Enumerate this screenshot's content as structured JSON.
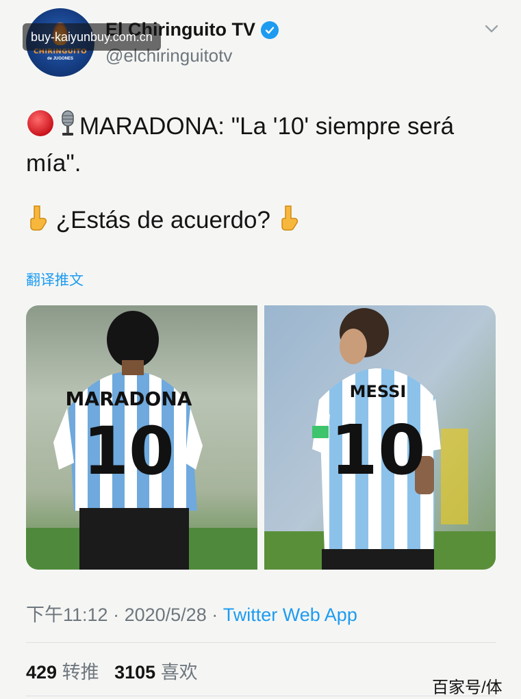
{
  "tweet": {
    "avatar_logo": "CHIRINGUITO",
    "avatar_logo_sub": "de JUGONES",
    "display_name": "El Chiringuito TV",
    "handle": "@elchiringuitotv",
    "line1": "MARADONA: \"La '10' siempre será",
    "line2": "mía\".",
    "line3": "¿Estás de acuerdo?",
    "translate_link": "翻译推文",
    "time": "下午11:12",
    "date": "2020/5/28",
    "separator": "·",
    "source_app": "Twitter Web App",
    "retweets_count": "429",
    "retweets_label": "转推",
    "likes_count": "3105",
    "likes_label": "喜欢"
  },
  "media": {
    "left_jersey_name": "MARADONA",
    "left_jersey_number": "10",
    "right_jersey_name": "MESSI",
    "right_jersey_number": "10"
  },
  "overlay": {
    "watermark": "buy-kaiyunbuy.com.cn",
    "source_tag": "百家号/体"
  },
  "icons": [
    "verified-badge-icon",
    "chevron-down-icon",
    "red-circle-emoji-icon",
    "microphone-emoji-icon",
    "pointing-down-emoji-icon"
  ],
  "colors": {
    "link": "#1d9bf0",
    "text": "#141414",
    "muted": "#6e767d",
    "background": "#f5f6f4"
  }
}
